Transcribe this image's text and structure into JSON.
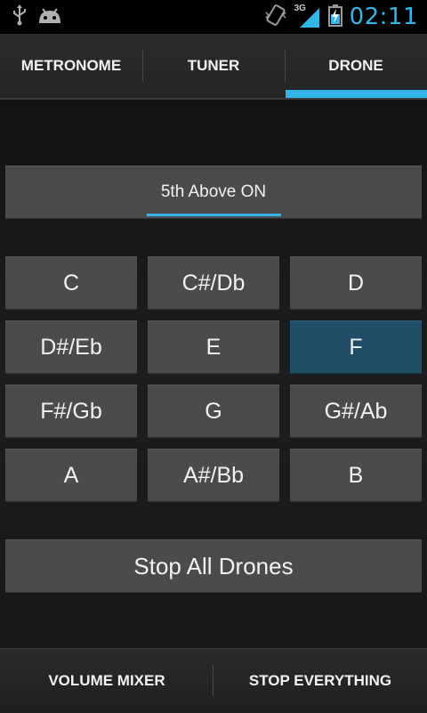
{
  "status_bar": {
    "time": "02:11",
    "network": "3G",
    "icons": [
      "usb-icon",
      "android-icon",
      "vibrate-icon",
      "signal-icon",
      "battery-charging-icon"
    ],
    "accent_color": "#33b5e5"
  },
  "tabs": [
    {
      "label": "METRONOME",
      "selected": false
    },
    {
      "label": "TUNER",
      "selected": false
    },
    {
      "label": "DRONE",
      "selected": true
    }
  ],
  "toggle": {
    "label": "5th Above ON"
  },
  "notes": [
    {
      "label": "C",
      "active": false
    },
    {
      "label": "C#/Db",
      "active": false
    },
    {
      "label": "D",
      "active": false
    },
    {
      "label": "D#/Eb",
      "active": false
    },
    {
      "label": "E",
      "active": false
    },
    {
      "label": "F",
      "active": true
    },
    {
      "label": "F#/Gb",
      "active": false
    },
    {
      "label": "G",
      "active": false
    },
    {
      "label": "G#/Ab",
      "active": false
    },
    {
      "label": "A",
      "active": false
    },
    {
      "label": "A#/Bb",
      "active": false
    },
    {
      "label": "B",
      "active": false
    }
  ],
  "stop_all": {
    "label": "Stop All Drones"
  },
  "bottom_bar": {
    "volume_mixer": "VOLUME MIXER",
    "stop_everything": "STOP EVERYTHING"
  },
  "colors": {
    "active_note": "#1f4e66",
    "button": "#4a4b4d",
    "indicator": "#33b5e5"
  }
}
